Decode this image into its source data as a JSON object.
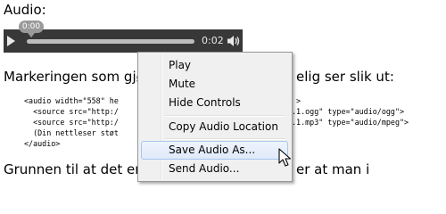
{
  "heading": "Audio:",
  "player": {
    "bubble": "0:00",
    "time": "0:02",
    "progress": 0.0
  },
  "para1_left": "Markeringen som gjø",
  "para1_right": "elig ser slik ut:",
  "code": {
    "line1_left": "<audio width=\"558\" he",
    "line1_right": ">",
    "line2_left": "  <source src=\"http:/",
    "line2_right": ".1.ogg\" type=\"audio/ogg\">",
    "line3_left": "  <source src=\"http:/",
    "line3_right": ".1.mp3\" type=\"audio/mpeg\">",
    "line4": "  (Din nettleser støt",
    "line5": "</audio>"
  },
  "para2_left": "Grunnen til at det er",
  "para2_right": "er at man i",
  "menu": {
    "items": [
      {
        "label": "Play"
      },
      {
        "label": "Mute"
      },
      {
        "label": "Hide Controls"
      },
      {
        "label": "Copy Audio Location"
      },
      {
        "label": "Save Audio As..."
      },
      {
        "label": "Send Audio..."
      }
    ]
  }
}
